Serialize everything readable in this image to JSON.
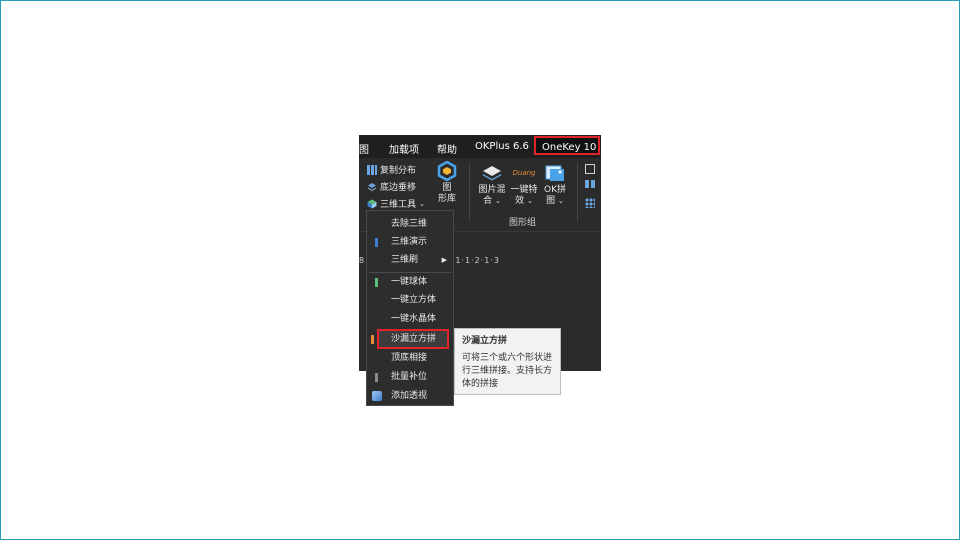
{
  "menubar": {
    "items": [
      "图",
      "加载项",
      "帮助",
      "OKPlus 6.6"
    ],
    "active": "OneKey 10"
  },
  "ribbon": {
    "copy_distribute": "复制分布",
    "bottom_stack": "底边垂移",
    "3d_tools": "三维工具",
    "shape_library": [
      "图",
      "形库"
    ],
    "picture_mix": [
      "图片混",
      "合"
    ],
    "one_click_effect": [
      "一键特",
      "效"
    ],
    "ok_puzzle": [
      "OK拼",
      "图"
    ],
    "effect_brand": "Duang",
    "group_label": "图形组"
  },
  "ruler": "8·1·3·1·2·1·1·1·0·1·1·1·2·1·3",
  "dropdown": {
    "items": [
      {
        "label": "去除三维"
      },
      {
        "label": "三维演示"
      },
      {
        "label": "三维刷",
        "submenu": true
      },
      {
        "label": "一键球体"
      },
      {
        "label": "一键立方体"
      },
      {
        "label": "一键水晶体"
      },
      {
        "label": "沙漏立方拼"
      },
      {
        "label": "顶底相接"
      },
      {
        "label": "批量补位"
      },
      {
        "label": "添加透视"
      }
    ]
  },
  "tooltip": {
    "title": "沙漏立方拼",
    "body_lines": [
      "可将三个或六个形状进",
      "行三维拼接。支持长方",
      "体的拼接"
    ]
  },
  "colors": {
    "accent_red": "#e0242c",
    "frame_teal": "#2a9bb3",
    "bg_dark": "#2b2b2b"
  }
}
